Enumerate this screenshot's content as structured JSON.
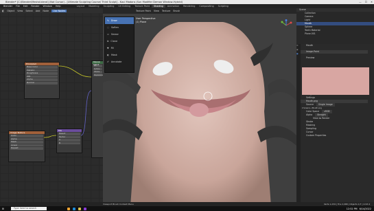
{
  "title": "Blender* [C:\\Blender\\Meshd.blend] (Not Cursor) - [Ultimate Sculpting Course/ Third Sculpt] - Kaul Madara (Sun Modifier Demon Window-Hybrid)",
  "menu": [
    "Blender",
    "File",
    "Edit",
    "Render",
    "Window",
    "Help"
  ],
  "workspaces": [
    "Layout",
    "Modeling",
    "Sculpting",
    "UV Editing",
    "Texture Paint",
    "Shading",
    "Animation",
    "Rendering",
    "Compositing",
    "Scripting"
  ],
  "active_workspace": "Shading",
  "node_header": [
    "Object",
    "View",
    "Select",
    "Add",
    "Node",
    "Use Nodes"
  ],
  "nodes": [
    {
      "title": "Principled",
      "rows": [
        "Base Color",
        "Metallic",
        "Roughness",
        "IOR",
        "Alpha",
        "Normal"
      ]
    },
    {
      "title": "Image Texture",
      "rows": [
        "Color",
        "Alpha",
        "Mesh",
        "Linear",
        "Repeat"
      ]
    },
    {
      "title": "Mix",
      "rows": [
        "Result",
        "Factor",
        "A",
        "B"
      ]
    },
    {
      "title": "Material Output",
      "rows": [
        "All",
        "Surface",
        "Volume",
        "Displacement"
      ]
    }
  ],
  "viewport": {
    "mode": "Texture Paint",
    "view": "User Perspective",
    "object": "(1) Plane",
    "header": [
      "View",
      "Texture",
      "Brush"
    ]
  },
  "tools": [
    "Draw",
    "Soften",
    "Smear",
    "Clone",
    "Fill",
    "Mask",
    "Annotate"
  ],
  "active_tool": "Draw",
  "outliner": {
    "title": "Scene",
    "items": [
      "Collection",
      "Camera",
      "Light",
      "Mouth",
      "Sphere",
      "Teeth Material",
      "Plane.001"
    ]
  },
  "props": {
    "object": "Mouth",
    "material": "Image.Paint",
    "sections": [
      "Preview",
      "Image",
      "Settings"
    ],
    "image": "Mouth.png",
    "source": "Single Image",
    "file": "C:\\Users\\...\\Mouth.png",
    "color_space": "sRGB",
    "alpha": "Straight",
    "view_as_render": "View as Render",
    "rows": [
      "Source",
      "Color Space",
      "Alpha"
    ],
    "extras": [
      "Stroke",
      "Masking",
      "Sampling",
      "Cursor",
      "Custom Properties"
    ]
  },
  "status": "Viewport Brush Context Menu",
  "version": "Verts 1,234 | Tris 2,468 | Objects 1/7 | 2.93.4",
  "taskbar": {
    "search": "Type here to search",
    "time": "12:52 PM",
    "date": "6/14/2022"
  },
  "colors": {
    "accent": "#4772b3",
    "selected": "#334d80"
  }
}
